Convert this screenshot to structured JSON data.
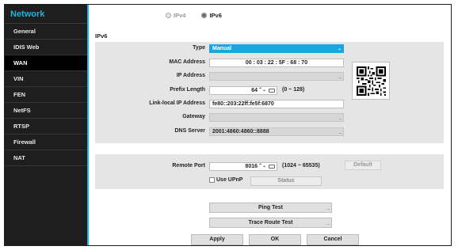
{
  "sidebar": {
    "title": "Network",
    "items": [
      {
        "label": "General"
      },
      {
        "label": "IDIS Web"
      },
      {
        "label": "WAN"
      },
      {
        "label": "VIN"
      },
      {
        "label": "FEN"
      },
      {
        "label": "NetFS"
      },
      {
        "label": "RTSP"
      },
      {
        "label": "Firewall"
      },
      {
        "label": "NAT"
      }
    ],
    "active": "WAN"
  },
  "ip_mode": {
    "options": [
      "IPv4",
      "IPv6"
    ],
    "selected": "IPv6"
  },
  "section_title": "IPv6",
  "form": {
    "type_label": "Type",
    "type_value": "Manual",
    "mac_label": "MAC Address",
    "mac_value": "00 : 03 : 22 : 5F : 68 : 70",
    "ip_label": "IP Address",
    "ip_value": "",
    "prefix_label": "Prefix Length",
    "prefix_value": "64",
    "prefix_range": "(0 ~ 128)",
    "linklocal_label": "Link-local IP Address",
    "linklocal_value": "fe80::203:22ff:fe5f:6870",
    "gateway_label": "Gateway",
    "gateway_value": "",
    "dns_label": "DNS Server",
    "dns_value": "2001:4860:4860::8888"
  },
  "remote": {
    "port_label": "Remote Port",
    "port_value": "8016",
    "port_range": "(1024 ~ 65535)",
    "default_label": "Default",
    "upnp_label": "Use UPnP",
    "upnp_checked": false,
    "status_label": "Status"
  },
  "tests": {
    "ping_label": "Ping Test",
    "trace_label": "Trace Route Test"
  },
  "footer": {
    "apply_label": "Apply",
    "ok_label": "OK",
    "cancel_label": "Cancel"
  },
  "colors": {
    "accent": "#1fb3e0",
    "select": "#1ba6df",
    "sidebar_bg": "#1e1e1e"
  }
}
